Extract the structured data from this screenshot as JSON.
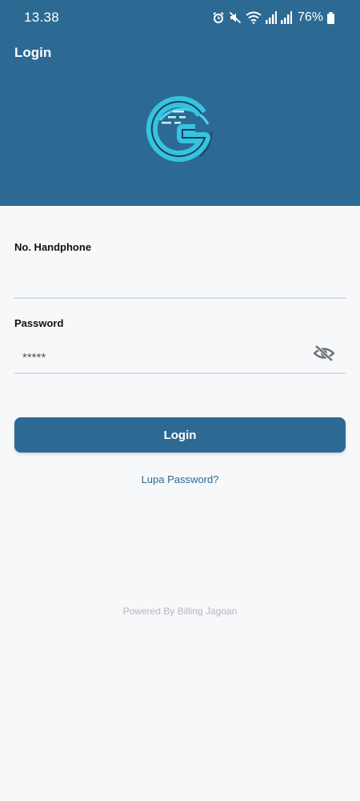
{
  "status_bar": {
    "time": "13.38",
    "battery": "76%",
    "icons": [
      "alarm-icon",
      "mute-icon",
      "wifi-icon",
      "signal-icon",
      "signal-icon",
      "battery-icon"
    ]
  },
  "header": {
    "title": "Login",
    "logo_icon": "g-logo-icon"
  },
  "form": {
    "phone_label": "No. Handphone",
    "phone_value": "",
    "password_label": "Password",
    "password_value": "*****",
    "visibility_icon": "eye-off-icon"
  },
  "actions": {
    "login_label": "Login",
    "forgot_label": "Lupa Password?"
  },
  "footer": {
    "powered_by": "Powered By Billing Jagoan"
  },
  "colors": {
    "primary": "#2c6a94",
    "background": "#f7f8fa",
    "accent": "#35c3e0"
  }
}
